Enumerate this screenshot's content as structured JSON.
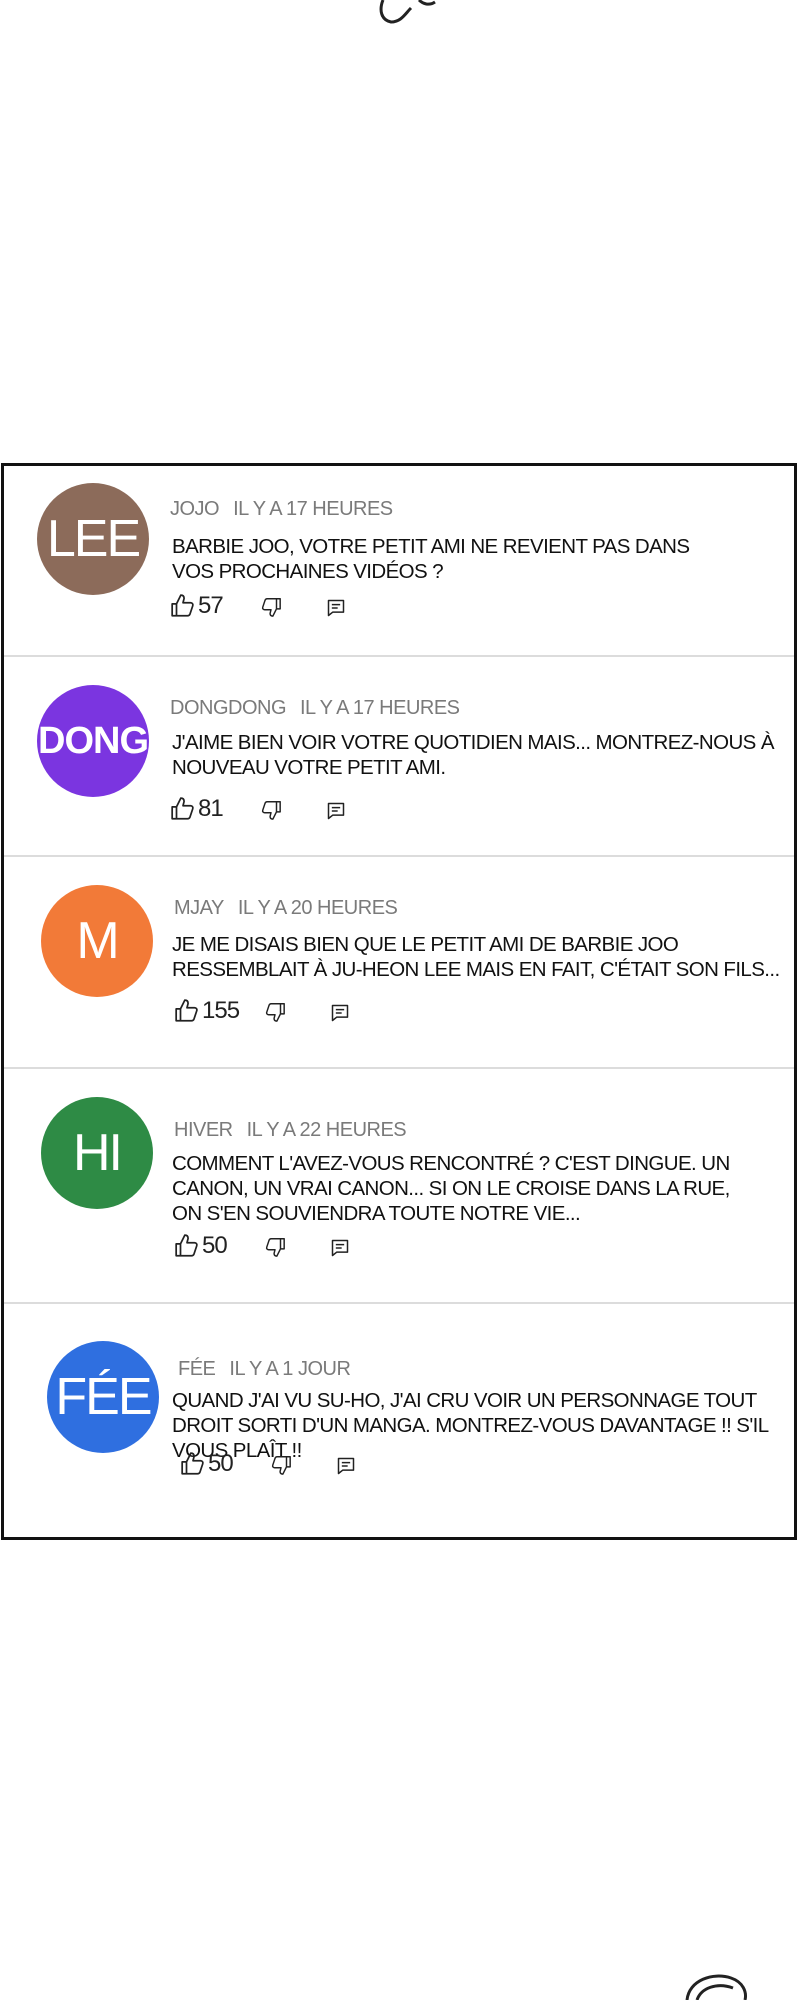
{
  "comments": [
    {
      "initials": "LEE",
      "author": "JOJO",
      "time": "IL Y A 17 HEURES",
      "text": "BARBIE JOO, VOTRE PETIT AMI NE REVIENT PAS DANS VOS PROCHAINES VIDÉOS ?",
      "likes": "57",
      "avatar_color": "#8c6b5a"
    },
    {
      "initials": "DONG",
      "author": "DONGDONG",
      "time": "IL Y A 17 HEURES",
      "text": "J'AIME BIEN VOIR VOTRE QUOTIDIEN MAIS... MONTREZ-NOUS À NOUVEAU VOTRE PETIT AMI.",
      "likes": "81",
      "avatar_color": "#7b35e0"
    },
    {
      "initials": "M",
      "author": "MJAY",
      "time": "IL Y A 20 HEURES",
      "text": "JE ME DISAIS BIEN QUE LE PETIT AMI DE BARBIE JOO RESSEMBLAIT À JU-HEON LEE MAIS EN FAIT, C'ÉTAIT SON FILS...",
      "likes": "155",
      "avatar_color": "#f27a38"
    },
    {
      "initials": "HI",
      "author": "HIVER",
      "time": "IL Y A 22 HEURES",
      "text": "COMMENT L'AVEZ-VOUS RENCONTRÉ ? C'EST DINGUE. UN CANON, UN VRAI CANON... SI ON LE CROISE DANS LA RUE, ON S'EN SOUVIENDRA TOUTE NOTRE VIE...",
      "likes": "50",
      "avatar_color": "#2e8b45"
    },
    {
      "initials": "FÉE",
      "author": "FÉE",
      "time": "IL Y A 1 JOUR",
      "text": "QUAND J'AI VU SU-HO, J'AI CRU VOIR UN PERSONNAGE TOUT DROIT SORTI D'UN MANGA. MONTREZ-VOUS DAVANTAGE !! S'IL VOUS PLAÎT !!",
      "likes": "50",
      "avatar_color": "#2f6fe0"
    }
  ],
  "icons": {
    "like": "thumbs-up-icon",
    "dislike": "thumbs-down-icon",
    "reply": "comment-icon"
  }
}
